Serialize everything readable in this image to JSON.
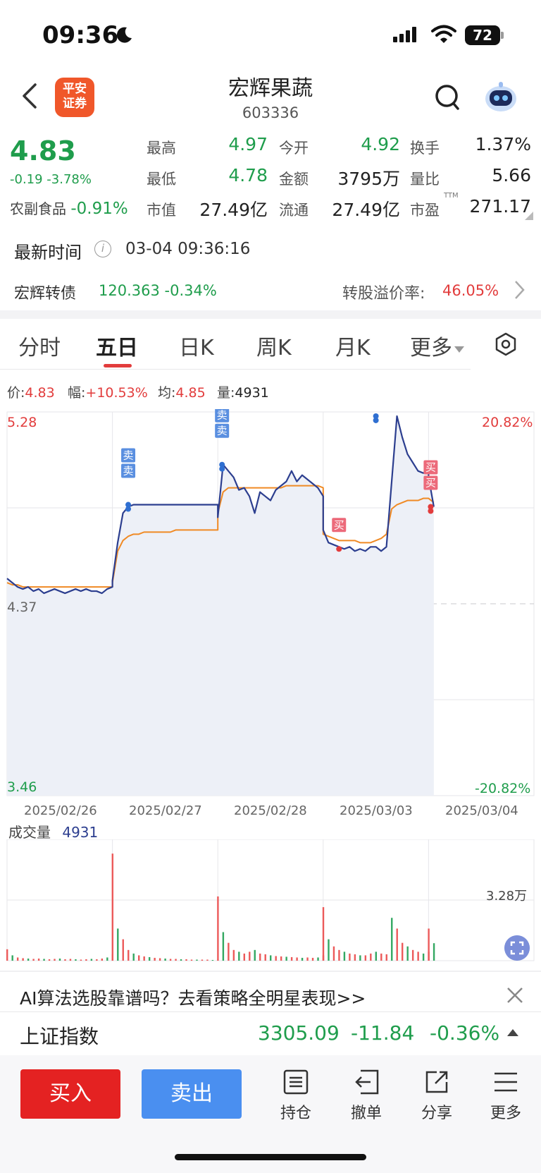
{
  "status_bar": {
    "time": "09:36",
    "battery": "72"
  },
  "header": {
    "title": "宏辉果蔬",
    "code": "603336",
    "broker_logo_text": [
      "平安",
      "证券"
    ],
    "icons": [
      "back-icon",
      "search-icon",
      "robot-assistant-icon"
    ]
  },
  "quote": {
    "price": "4.83",
    "change": "-0.19 -3.78%",
    "sector_name": "农副食品",
    "sector_change": "-0.91%",
    "fields": [
      {
        "label": "最高",
        "value": "4.97",
        "color": "#1f9d4c"
      },
      {
        "label": "今开",
        "value": "4.92",
        "color": "#1f9d4c"
      },
      {
        "label": "换手",
        "value": "1.37%",
        "color": "#222222"
      },
      {
        "label": "最低",
        "value": "4.78",
        "color": "#1f9d4c"
      },
      {
        "label": "金额",
        "value": "3795万",
        "color": "#222222"
      },
      {
        "label": "量比",
        "value": "5.66",
        "color": "#222222"
      },
      {
        "label": "市值",
        "value": "27.49亿",
        "color": "#222222"
      },
      {
        "label": "流通",
        "value": "27.49亿",
        "color": "#222222"
      },
      {
        "label": "市盈",
        "value": "271.17",
        "color": "#222222"
      }
    ],
    "ttm": "TTM",
    "latest_time_label": "最新时间",
    "latest_time": "03-04 09:36:16"
  },
  "bond": {
    "name": "宏辉转债",
    "value": "120.363  -0.34%",
    "premium_label": "转股溢价率:",
    "premium_value": "46.05%"
  },
  "tabs": [
    "分时",
    "五日",
    "日K",
    "周K",
    "月K",
    "更多"
  ],
  "active_tab": "五日",
  "chart_stats": {
    "price_label": "价:",
    "price": "4.83",
    "range_label": "幅:",
    "range": "+10.53%",
    "avg_label": "均:",
    "avg": "4.85",
    "vol_label": "量:",
    "vol": "4931"
  },
  "chart_axis": {
    "top_price": "5.28",
    "mid_price": "4.37",
    "bottom_price": "3.46",
    "top_pct": "20.82%",
    "bottom_pct": "-20.82%",
    "vol_label": "成交量",
    "vol_value": "4931",
    "vol_max": "3.28万"
  },
  "chart_data": {
    "type": "line",
    "x": [
      "2025/02/26",
      "2025/02/27",
      "2025/02/28",
      "2025/03/03",
      "2025/03/04"
    ],
    "ylim": [
      3.46,
      5.28
    ],
    "reference": 4.37,
    "series": [
      {
        "name": "价",
        "color": "#2c3e8f",
        "days": [
          [
            4.49,
            4.47,
            4.45,
            4.44,
            4.45,
            4.43,
            4.44,
            4.42,
            4.43,
            4.44,
            4.43,
            4.42,
            4.43,
            4.44,
            4.43,
            4.44,
            4.43,
            4.43,
            4.42,
            4.44,
            4.45
          ],
          [
            4.48,
            4.66,
            4.8,
            4.83,
            4.84,
            4.84,
            4.84,
            4.84,
            4.84,
            4.84,
            4.84,
            4.84,
            4.84,
            4.84,
            4.84,
            4.84,
            4.84,
            4.84,
            4.84,
            4.84,
            4.84
          ],
          [
            4.78,
            5.03,
            5.0,
            4.97,
            4.91,
            4.92,
            4.88,
            4.8,
            4.9,
            4.88,
            4.86,
            4.91,
            4.93,
            4.95,
            5.0,
            4.95,
            4.98,
            4.96,
            4.94,
            4.92,
            4.88
          ],
          [
            4.72,
            4.66,
            4.65,
            4.64,
            4.63,
            4.64,
            4.62,
            4.63,
            4.62,
            4.64,
            4.64,
            4.62,
            4.64,
            4.95,
            5.26,
            5.16,
            5.08,
            5.04,
            5.0,
            4.99,
            5.0
          ],
          [
            4.97,
            4.83
          ]
        ]
      },
      {
        "name": "均",
        "color": "#f08a24",
        "days": [
          [
            4.47,
            4.46,
            4.46,
            4.45,
            4.45,
            4.45,
            4.45,
            4.45,
            4.45,
            4.45,
            4.45,
            4.45,
            4.45,
            4.45,
            4.45,
            4.45,
            4.45,
            4.45,
            4.45,
            4.45,
            4.45
          ],
          [
            4.47,
            4.62,
            4.67,
            4.69,
            4.7,
            4.7,
            4.71,
            4.71,
            4.71,
            4.71,
            4.71,
            4.71,
            4.72,
            4.72,
            4.72,
            4.72,
            4.72,
            4.72,
            4.72,
            4.72,
            4.72
          ],
          [
            4.8,
            4.9,
            4.92,
            4.92,
            4.92,
            4.92,
            4.92,
            4.92,
            4.92,
            4.92,
            4.92,
            4.92,
            4.92,
            4.93,
            4.93,
            4.93,
            4.93,
            4.93,
            4.93,
            4.93,
            4.92
          ],
          [
            4.7,
            4.69,
            4.68,
            4.67,
            4.67,
            4.67,
            4.67,
            4.66,
            4.66,
            4.66,
            4.67,
            4.68,
            4.7,
            4.82,
            4.84,
            4.85,
            4.86,
            4.86,
            4.86,
            4.87,
            4.87
          ],
          [
            4.87,
            4.85
          ]
        ]
      }
    ],
    "trade_markers": [
      {
        "day": "2025/02/27",
        "label": "卖",
        "price": 4.84
      },
      {
        "day": "2025/02/27",
        "label": "卖",
        "price": 4.84
      },
      {
        "day": "2025/02/28",
        "label": "卖",
        "price": 5.03
      },
      {
        "day": "2025/02/28",
        "label": "卖",
        "price": 5.03
      },
      {
        "day": "2025/03/03",
        "label": "买",
        "price": 4.63
      },
      {
        "day": "2025/03/03",
        "label": "卖",
        "price": 5.26
      },
      {
        "day": "2025/03/03",
        "label": "卖",
        "price": 5.26
      },
      {
        "day": "2025/03/04",
        "label": "买",
        "price": 4.83
      },
      {
        "day": "2025/03/04",
        "label": "买",
        "price": 4.83
      }
    ],
    "volume": {
      "ylim": [
        0,
        32800
      ],
      "days": [
        [
          3200,
          1500,
          900,
          700,
          600,
          500,
          600,
          500,
          400,
          500,
          600,
          400,
          500,
          400,
          300,
          400,
          500,
          400,
          600,
          900,
          1800
        ],
        [
          30000,
          9000,
          6000,
          3000,
          2000,
          1500,
          1200,
          1000,
          800,
          700,
          600,
          500,
          500,
          400,
          400,
          300,
          300,
          300,
          300,
          200,
          200
        ],
        [
          18000,
          8000,
          5000,
          3000,
          2500,
          2000,
          2500,
          3000,
          2000,
          1800,
          1500,
          1300,
          1200,
          1100,
          1000,
          900,
          800,
          900,
          800,
          900,
          1500
        ],
        [
          15000,
          6000,
          4000,
          3000,
          2500,
          2000,
          1800,
          1500,
          1500,
          2000,
          2500,
          2000,
          1800,
          12000,
          9000,
          5000,
          4000,
          3000,
          2500,
          2000,
          2500
        ],
        [
          9000,
          4900
        ]
      ]
    }
  },
  "promo": {
    "text": "AI算法选股靠谱吗？去看策略全明星表现>>"
  },
  "index": {
    "name": "上证指数",
    "value": "3305.09",
    "change": "-11.84",
    "pct": "-0.36%"
  },
  "actions": {
    "buy": "买入",
    "sell": "卖出",
    "items": [
      "持仓",
      "撤单",
      "分享",
      "更多"
    ]
  }
}
